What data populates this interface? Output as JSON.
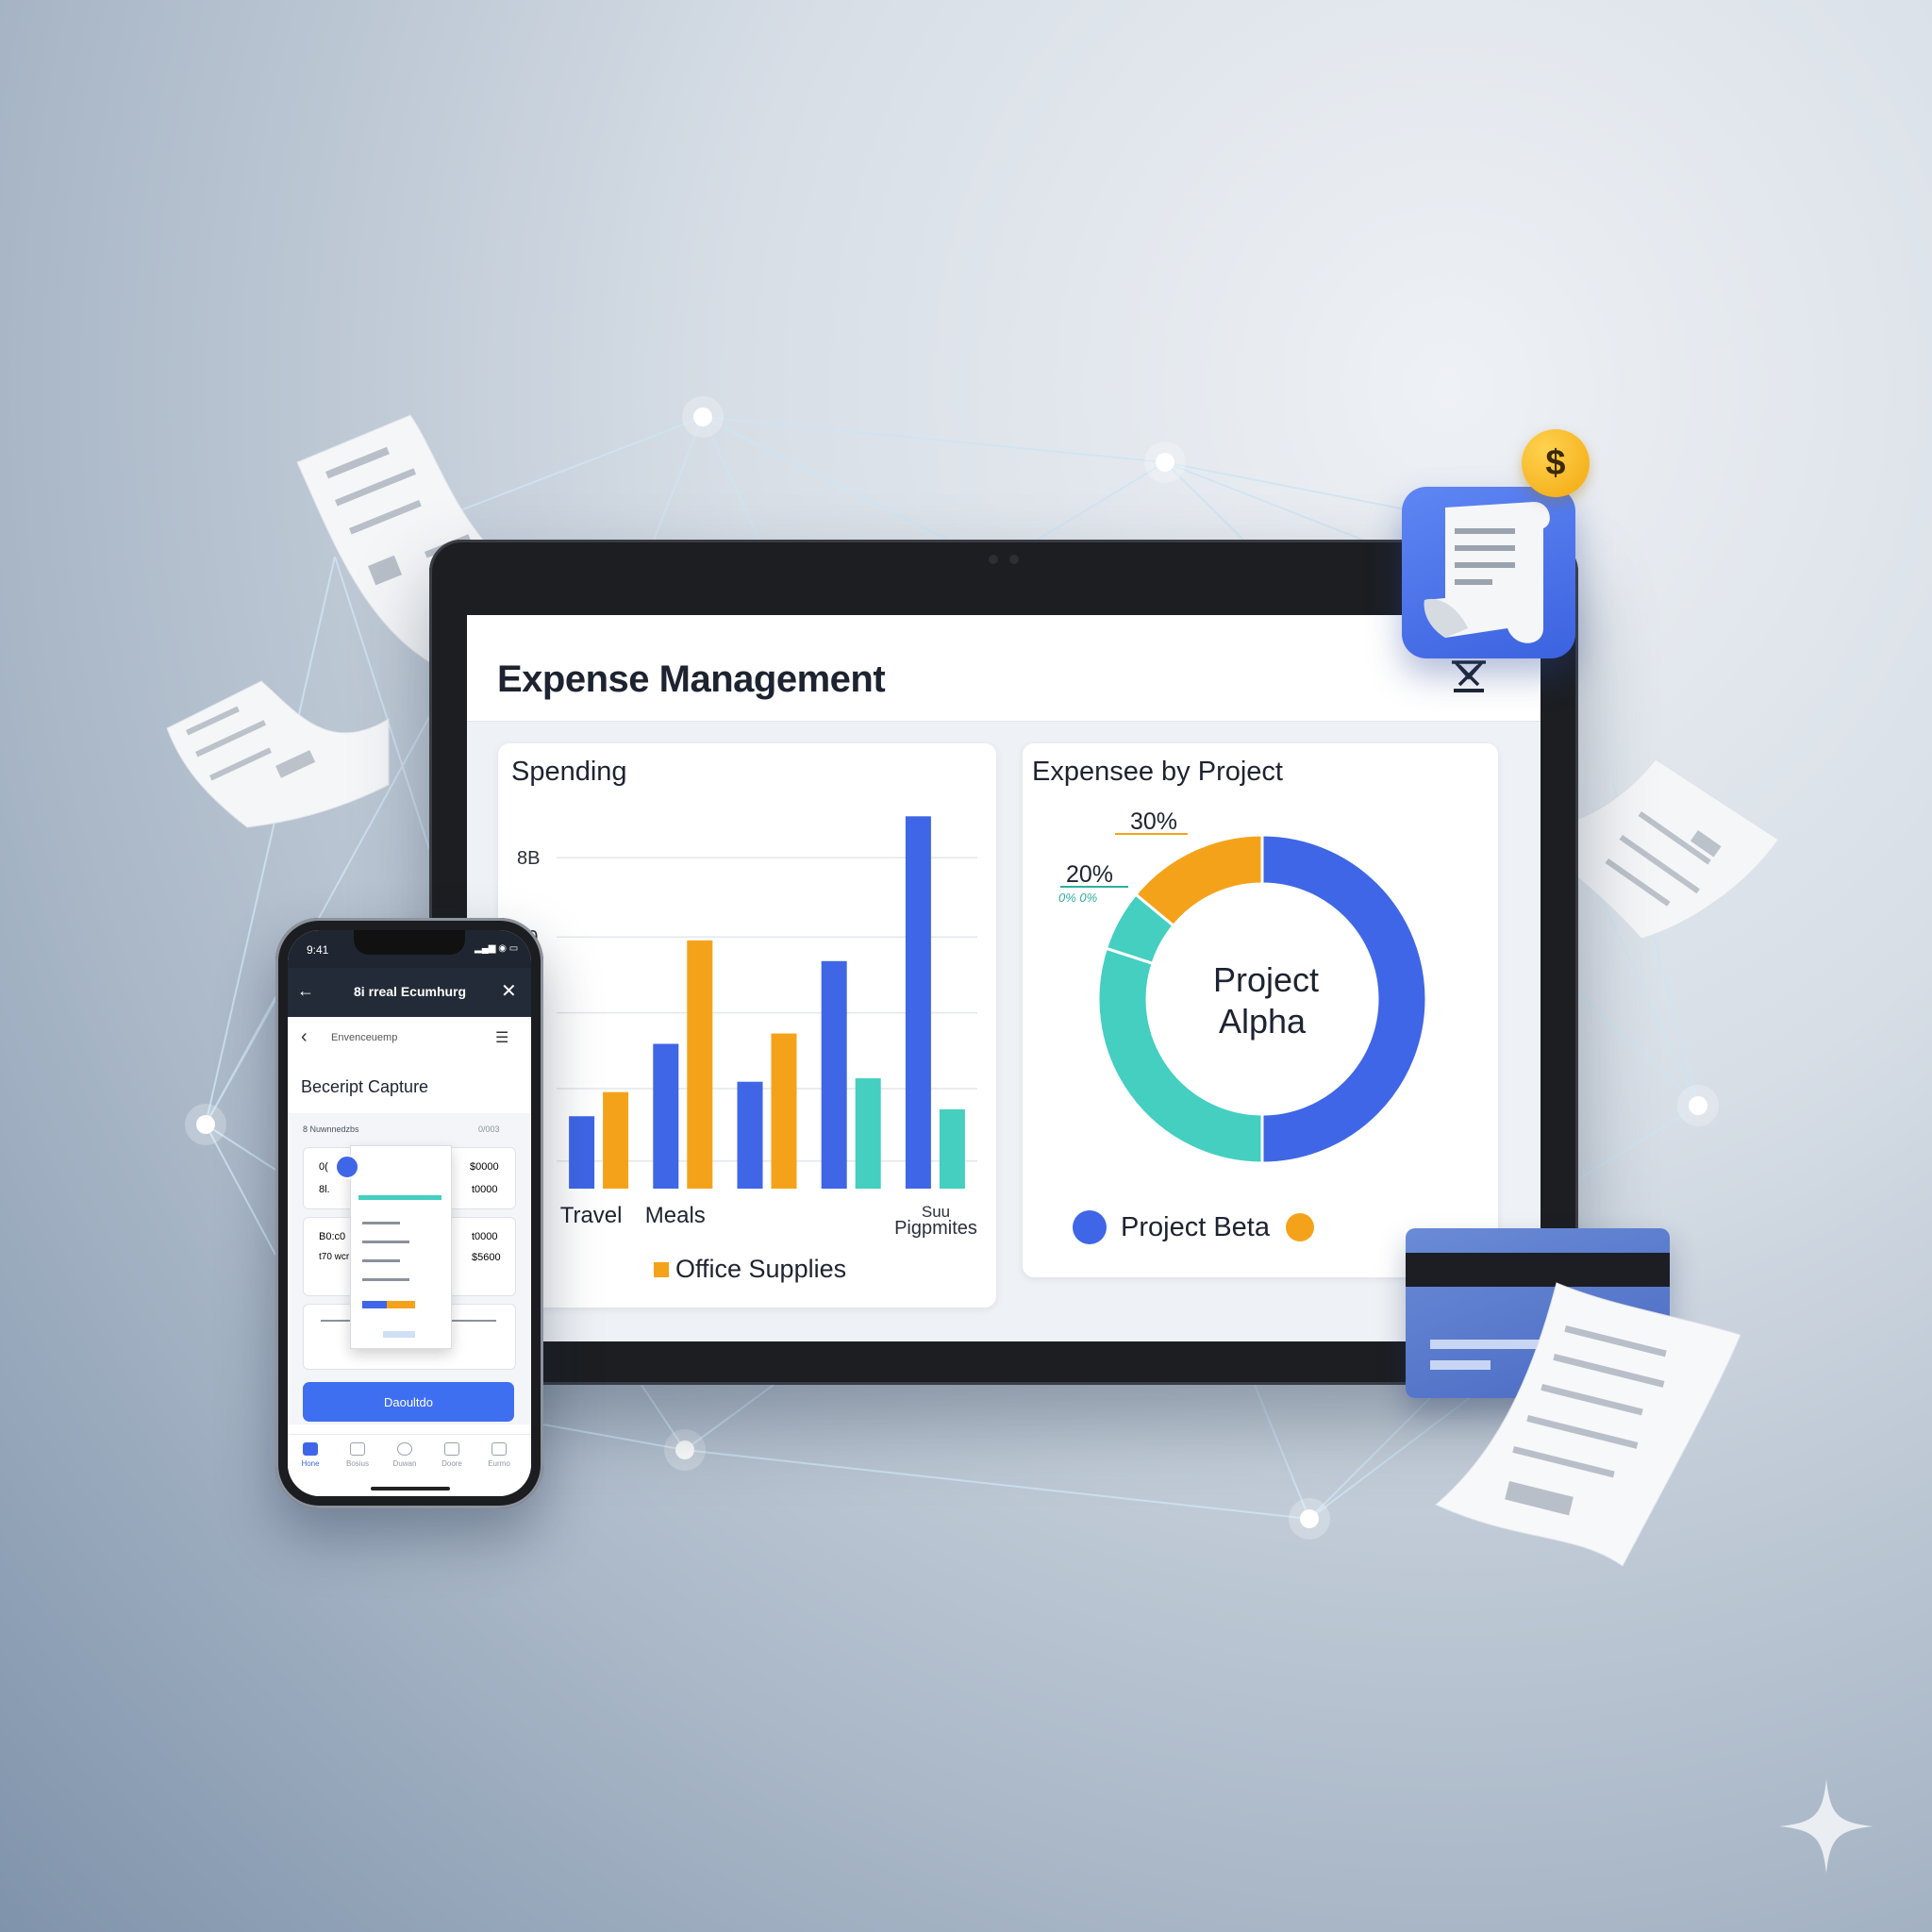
{
  "app": {
    "title": "Expense Management"
  },
  "spending_card": {
    "title": "Spending",
    "legend_label": "Office Supplies",
    "category_extra_label_1": "Suu",
    "category_extra_label_2": "Pigpmites"
  },
  "project_card": {
    "title": "Expensee by Project",
    "center_label_line1": "Project",
    "center_label_line2": "Alpha",
    "legend_label": "Project Beta",
    "pct_30": "30%",
    "pct_20": "20%",
    "pct_small": "0% 0%"
  },
  "phone": {
    "status_time": "9:41",
    "nav_title": "8i rreal Ecumhurg",
    "sub_title": "Envenceuemp",
    "page_title": "Beceript Capture",
    "list_header_left": "8 Nuwnnedzbs",
    "list_header_right": "0/003",
    "rows": [
      {
        "left": "0(",
        "left2": "8l.",
        "amt1": "$0000",
        "amt2": "t0000"
      },
      {
        "left": "B0:c0",
        "left2": "t70 wcr",
        "amt1": "t0000",
        "amt2": "$5600"
      }
    ],
    "button_label": "Daoultdo",
    "tabs": [
      "Hone",
      "Bosius",
      "Duwan",
      "Doore",
      "Eurmo"
    ]
  },
  "badges": {
    "dollar": "$"
  },
  "colors": {
    "blue": "#3f66e6",
    "orange": "#f5a21b",
    "teal": "#44cfc0",
    "accent_button": "#3f6ff1"
  },
  "chart_data": [
    {
      "type": "bar",
      "title": "Spending",
      "categories": [
        "Travel",
        "Meals",
        "",
        "",
        ""
      ],
      "y_tick_labels": [
        "60",
        "8B"
      ],
      "series": [
        {
          "color": "#3f66e6",
          "values": [
            21,
            42,
            31,
            66,
            108
          ]
        },
        {
          "color": "#f5a21b",
          "values": [
            28,
            72,
            45,
            null,
            null
          ]
        },
        {
          "color": "#44cfc0",
          "values": [
            null,
            null,
            null,
            32,
            23
          ]
        }
      ],
      "legend": [
        {
          "name": "Office Supplies",
          "color": "#f5a21b"
        }
      ],
      "grid": true,
      "ylim": [
        0,
        110
      ]
    },
    {
      "type": "pie",
      "title": "Expensee by Project",
      "slices": [
        {
          "label": "Project Alpha",
          "value": 50,
          "color": "#3f66e6"
        },
        {
          "label": "",
          "value": 30,
          "color": "#44cfc0"
        },
        {
          "label": "",
          "value": 6,
          "color": "#44cfc0"
        },
        {
          "label": "",
          "value": 14,
          "color": "#f5a21b"
        }
      ],
      "annotations": [
        "30%",
        "20%"
      ],
      "legend": [
        {
          "name": "Project Beta",
          "color": "#3f66e6"
        },
        {
          "name": "",
          "color": "#f5a21b"
        }
      ]
    }
  ]
}
